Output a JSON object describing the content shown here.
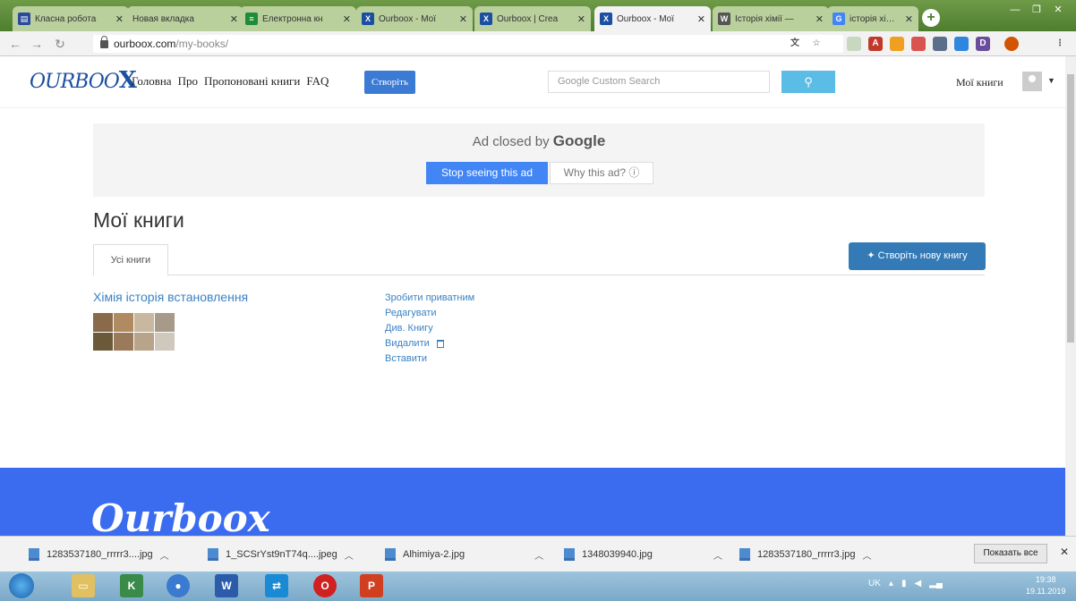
{
  "browser": {
    "tabs": [
      {
        "title": "Класна робота",
        "favicon": "classroom-icon",
        "color": "#2a4a9a"
      },
      {
        "title": "Новая вкладка",
        "favicon": "",
        "color": ""
      },
      {
        "title": "Електронна кн",
        "favicon": "book-icon",
        "color": "#1f8b3a"
      },
      {
        "title": "Ourboox - Мої",
        "favicon": "ourboox-icon",
        "color": "#1b4fa0"
      },
      {
        "title": "Ourboox | Crea",
        "favicon": "ourboox-icon",
        "color": "#1b4fa0"
      },
      {
        "title": "Ourboox - Мої",
        "favicon": "ourboox-icon",
        "color": "#1b4fa0",
        "active": true
      },
      {
        "title": "Історія хімії —",
        "favicon": "wikipedia-icon",
        "color": "#555555"
      },
      {
        "title": "історія хімії - Г",
        "favicon": "google-icon",
        "color": "#4285f4"
      }
    ],
    "url_host": "ourboox.com",
    "url_path": "/my-books/"
  },
  "site": {
    "logo_text": "OURBOO",
    "logo_x": "X",
    "nav": [
      "Головна",
      "Про",
      "Пропоновані книги",
      "FAQ"
    ],
    "create_label": "Створіть",
    "search_placeholder": "Google Custom Search",
    "my_books_label": "Мої книги"
  },
  "ad": {
    "closed_text": "Ad closed by",
    "closed_brand": "Google",
    "stop_label": "Stop seeing this ad",
    "why_label": "Why this ad? ⓘ"
  },
  "page": {
    "title": "Мої книги",
    "tab_all": "Усі книги",
    "new_book_label": "✦ Створіть нову книгу",
    "book": {
      "title": "Хімія історія встановлення",
      "actions": {
        "make_private": "Зробити приватним",
        "edit": "Редагувати",
        "view": "Див. Книгу",
        "delete": "Видалити",
        "embed": "Вставити"
      }
    },
    "footer_logo": "Ourboox"
  },
  "downloads": {
    "items": [
      "1283537180_rrrrr3....jpg",
      "1_SCSrYst9nT74q....jpeg",
      "Alhimiya-2.jpg",
      "1348039940.jpg",
      "1283537180_rrrrr3.jpg"
    ],
    "show_all": "Показать все"
  },
  "taskbar": {
    "lang": "UK",
    "time": "19:38",
    "date": "19.11.2019"
  }
}
